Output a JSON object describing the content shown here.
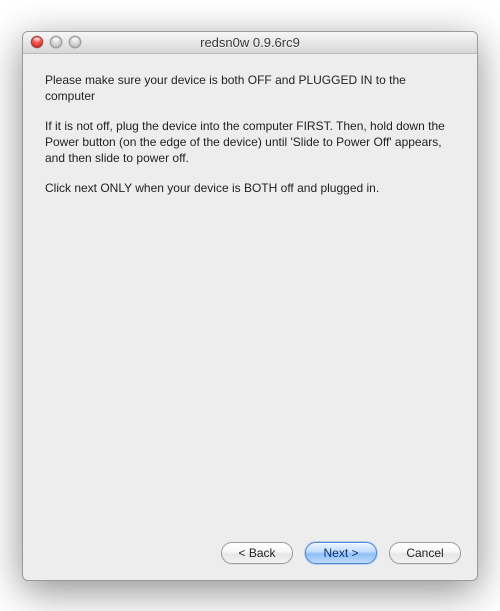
{
  "window": {
    "title": "redsn0w 0.9.6rc9"
  },
  "content": {
    "para1": "Please make sure your device is both OFF and PLUGGED IN to the computer",
    "para2": "If it is not off, plug the device into the computer FIRST. Then, hold down the Power button (on the edge of the device) until 'Slide to Power Off' appears, and then slide to power off.",
    "para3": "Click next ONLY when your device is BOTH off and plugged in."
  },
  "buttons": {
    "back": "< Back",
    "next": "Next >",
    "cancel": "Cancel"
  }
}
